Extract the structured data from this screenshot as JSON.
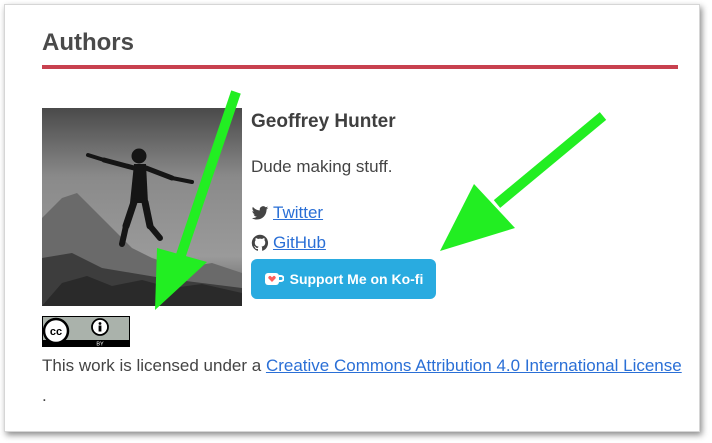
{
  "section": {
    "title": "Authors"
  },
  "author": {
    "name": "Geoffrey Hunter",
    "bio": "Dude making stuff.",
    "twitter_label": "Twitter",
    "github_label": "GitHub",
    "kofi_label": "Support Me on Ko-fi"
  },
  "license": {
    "prefix": "This work is licensed under a ",
    "link_text": "Creative Commons Attribution 4.0 International License ",
    "suffix": ".",
    "badge_label": "BY"
  },
  "colors": {
    "accent_rule": "#c8414f",
    "link": "#2a6fd6",
    "kofi_button": "#29abe0",
    "annotation_arrow": "#22ee22"
  },
  "icons": [
    "twitter-icon",
    "github-icon",
    "kofi-cup-icon",
    "creative-commons-icon",
    "attribution-icon"
  ]
}
